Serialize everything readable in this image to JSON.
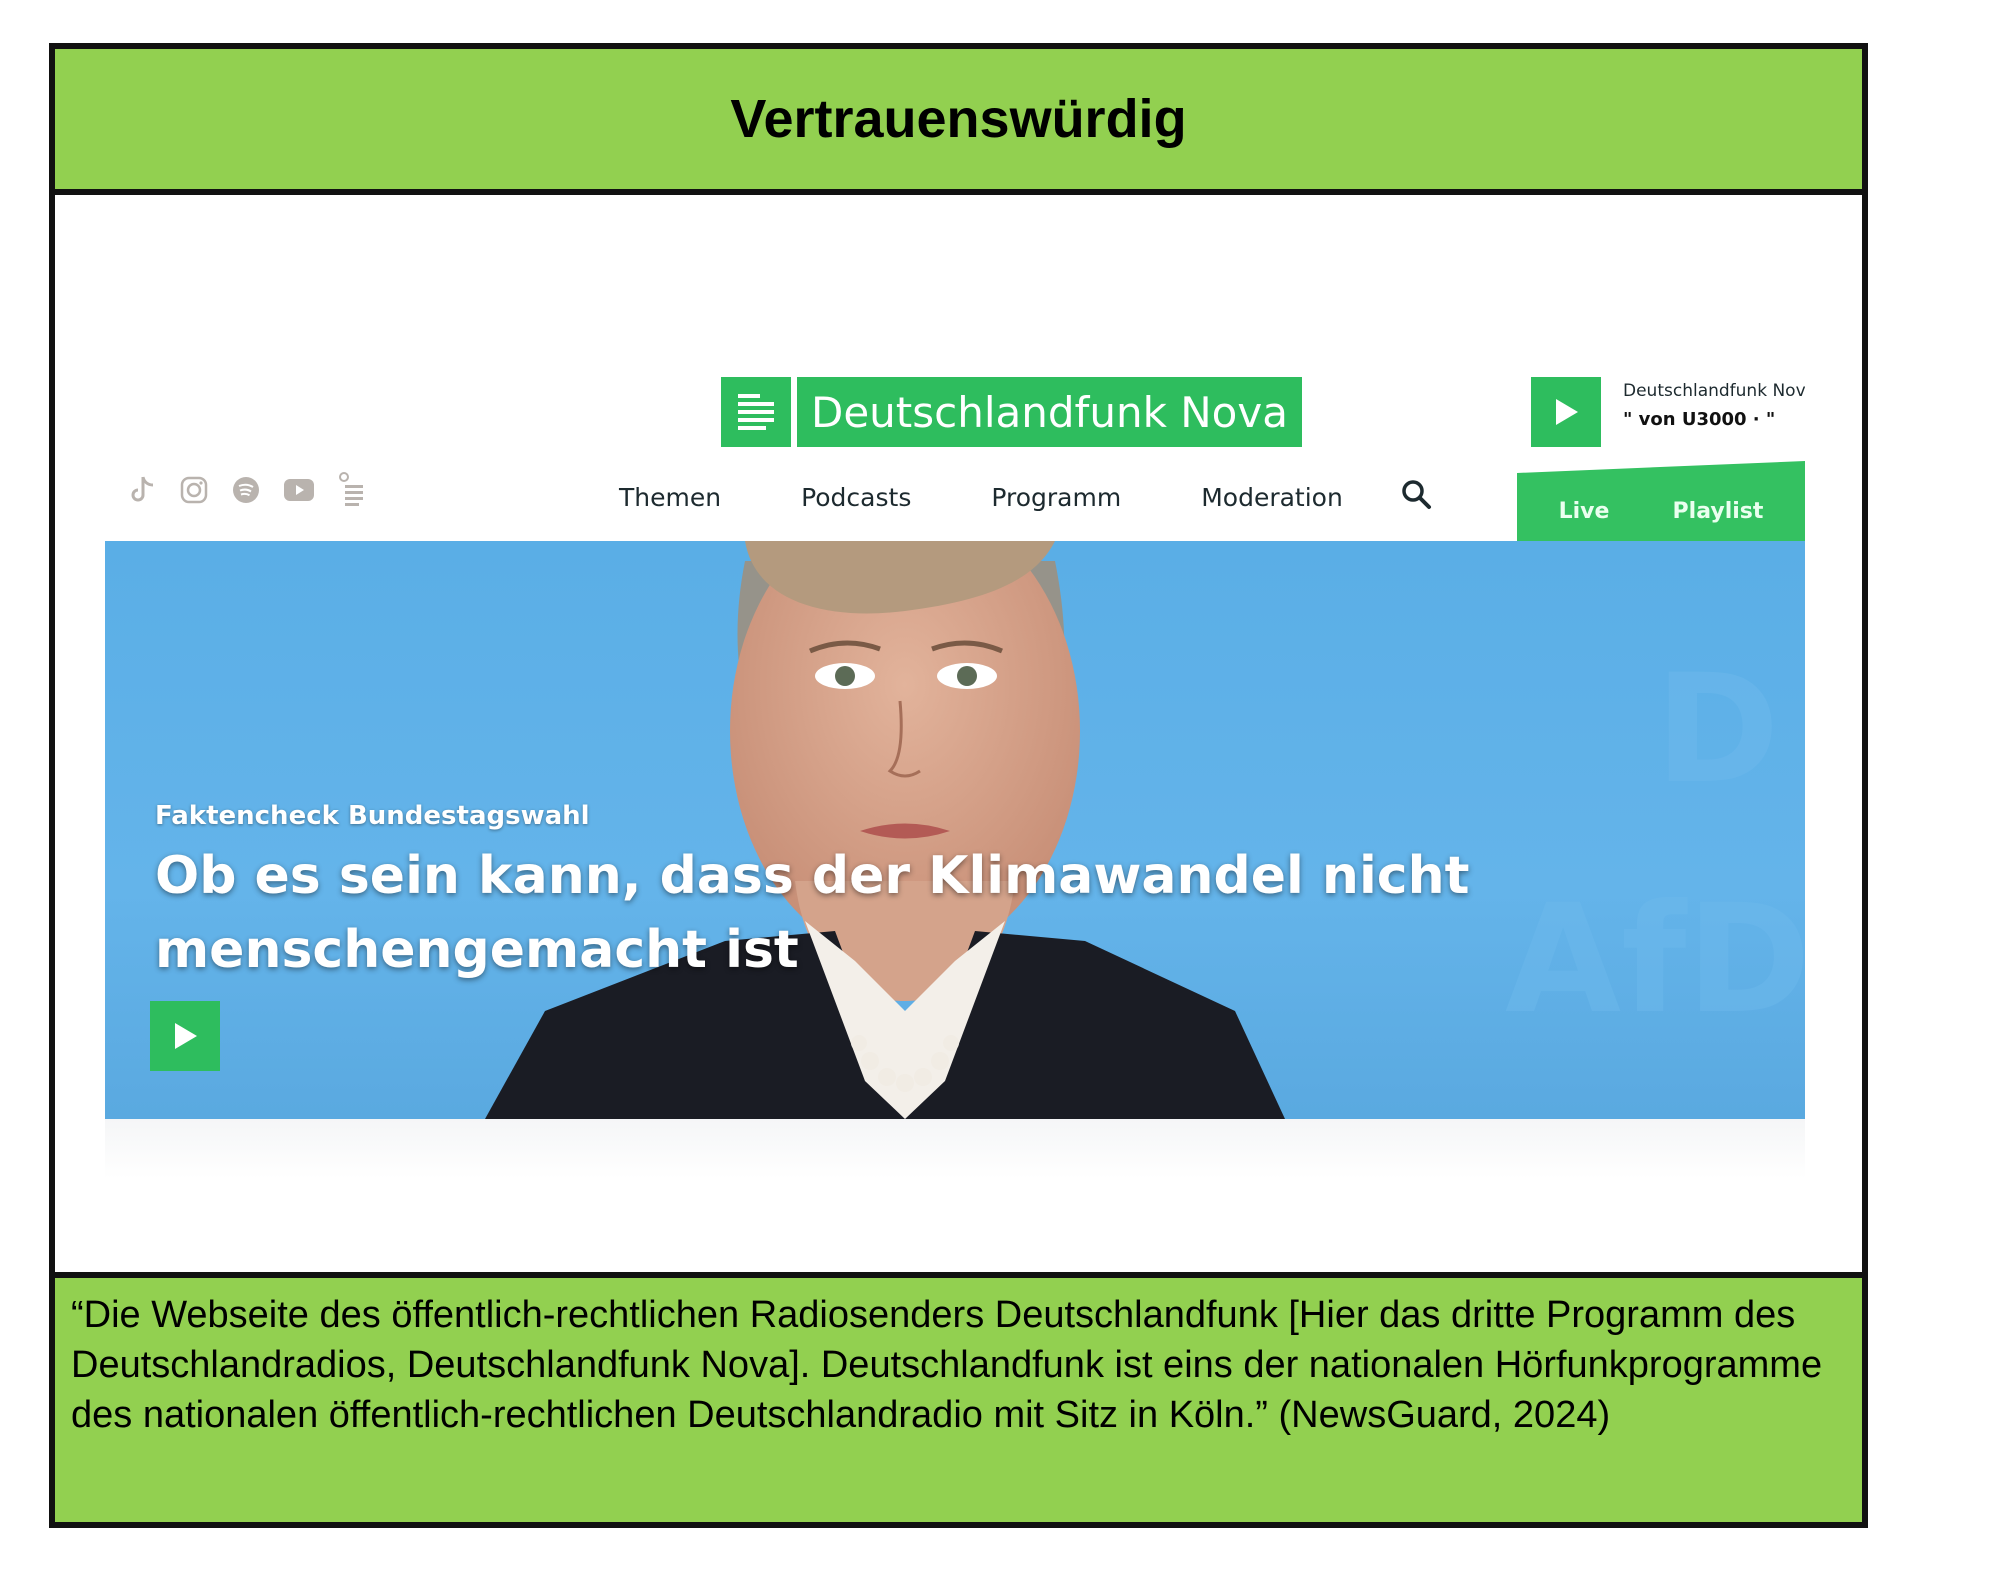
{
  "header": {
    "title": "Vertrauenswürdig"
  },
  "site": {
    "logo_text": "Deutschlandfunk Nova",
    "now_playing": {
      "station": "Deutschlandfunk Nova",
      "track": "\" von U3000  ·  \""
    },
    "social_icons": [
      "tiktok-icon",
      "instagram-icon",
      "spotify-icon",
      "youtube-icon",
      "podcast-feed-icon"
    ],
    "nav": [
      "Themen",
      "Podcasts",
      "Programm",
      "Moderation"
    ],
    "live_tab": {
      "live": "Live",
      "playlist": "Playlist"
    },
    "hero": {
      "kicker": "Faktencheck Bundestagswahl",
      "headline": "Ob es sein kann, dass der Klimawandel nicht menschengemacht ist"
    },
    "colors": {
      "brand_green": "#2ebd5e",
      "hero_blue": "#5aaee6"
    }
  },
  "caption": {
    "text": "“Die Webseite des öffentlich-rechtlichen Radiosenders Deutschlandfunk [Hier das dritte Programm des Deutschlandradios, Deutschlandfunk Nova]. Deutschlandfunk ist eins der nationalen Hörfunkprogramme des nationalen öffentlich-rechtlichen Deutschlandradio mit Sitz in Köln.” (NewsGuard, 2024)"
  },
  "frame_colors": {
    "band": "#92d050",
    "border": "#111111"
  }
}
